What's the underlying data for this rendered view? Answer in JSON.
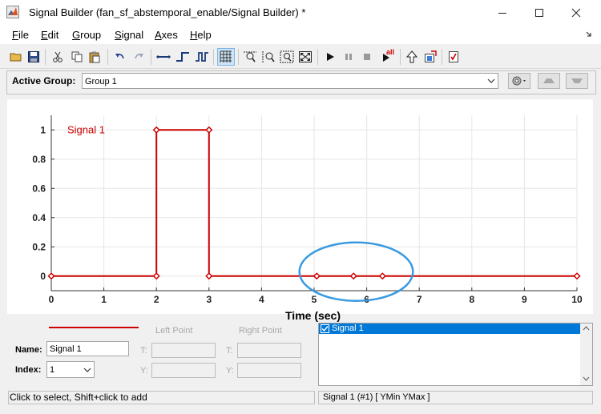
{
  "window": {
    "title": "Signal Builder (fan_sf_abstemporal_enable/Signal Builder) *",
    "controls": [
      "minimize",
      "maximize",
      "close"
    ]
  },
  "menu": [
    {
      "accel": "F",
      "rest": "ile"
    },
    {
      "accel": "E",
      "rest": "dit"
    },
    {
      "accel": "G",
      "rest": "roup"
    },
    {
      "accel": "S",
      "rest": "ignal"
    },
    {
      "accel": "A",
      "rest": "xes"
    },
    {
      "accel": "H",
      "rest": "elp"
    }
  ],
  "toolbar": {
    "icons": [
      "open-icon",
      "save-icon",
      "cut-icon",
      "copy-icon",
      "paste-icon",
      "undo-icon",
      "redo-icon",
      "constant-signal-icon",
      "step-signal-icon",
      "pulse-signal-icon",
      "grid-icon",
      "zoom-x-icon",
      "zoom-y-icon",
      "zoom-xy-icon",
      "fit-icon",
      "play-icon",
      "pause-icon",
      "stop-icon",
      "play-all-icon",
      "up-arrow-icon",
      "signal-export-icon",
      "verify-icon"
    ],
    "play_all_label": "all"
  },
  "group_bar": {
    "label": "Active Group:",
    "selected": "Group 1",
    "buttons": [
      "settings-icon",
      "move-group-up-icon",
      "move-group-down-icon"
    ]
  },
  "plot": {
    "signal_label": "Signal 1",
    "xlabel": "Time (sec)",
    "line_color": "#cc0000",
    "highlight_color": "#3a9ae0"
  },
  "chart_data": {
    "type": "line",
    "title": "",
    "xlabel": "Time (sec)",
    "ylabel": "",
    "xlim": [
      0,
      10
    ],
    "ylim": [
      -0.1,
      1.1
    ],
    "xticks": [
      0,
      1,
      2,
      3,
      4,
      5,
      6,
      7,
      8,
      9,
      10
    ],
    "yticks": [
      0,
      0.2,
      0.4,
      0.6,
      0.8,
      1
    ],
    "ytick_labels": [
      "0",
      "0.2",
      "0.4",
      "0.6",
      "0.8",
      "1"
    ],
    "grid": true,
    "series": [
      {
        "name": "Signal 1",
        "x": [
          0,
          2,
          2,
          3,
          3,
          10
        ],
        "y": [
          0,
          0,
          1,
          1,
          0,
          0
        ],
        "markers": [
          [
            0,
            0
          ],
          [
            2,
            0
          ],
          [
            2,
            1
          ],
          [
            3,
            1
          ],
          [
            3,
            0
          ],
          [
            5.05,
            0
          ],
          [
            5.75,
            0
          ],
          [
            6.3,
            0
          ],
          [
            10,
            0
          ]
        ]
      }
    ],
    "highlight_ellipse": {
      "x_center": 5.8,
      "y_center": 0.03,
      "x_radius": 1.08,
      "y_radius": 0.2
    }
  },
  "point_editor": {
    "legend_line_color": "#cc0000",
    "left_point": "Left Point",
    "right_point": "Right Point",
    "name_label": "Name:",
    "name_value": "Signal 1",
    "index_label": "Index:",
    "index_value": "1",
    "t_label": "T:",
    "y_label": "Y:",
    "left_t": "",
    "left_y": "",
    "right_t": "",
    "right_y": ""
  },
  "signal_list": {
    "items": [
      {
        "label": "Signal 1",
        "checked": true
      }
    ]
  },
  "status": {
    "left": "Click to select, Shift+click to add",
    "right": "Signal 1 (#1)  [ YMin YMax ]"
  }
}
